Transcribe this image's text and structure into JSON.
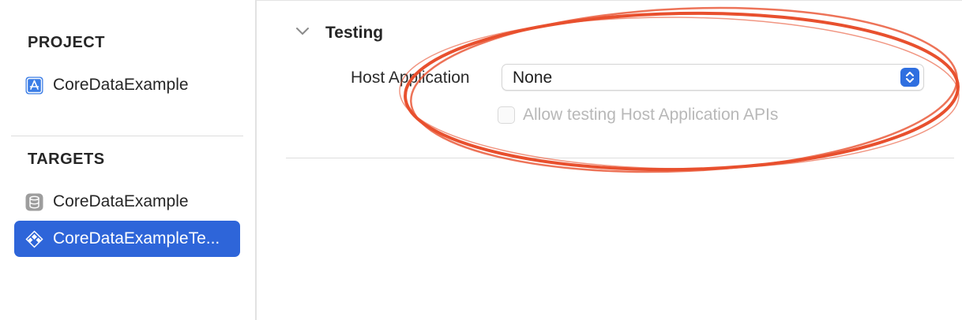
{
  "sidebar": {
    "project_title": "PROJECT",
    "project_item": {
      "label": "CoreDataExample",
      "icon": "app-store-icon"
    },
    "targets_title": "TARGETS",
    "targets": [
      {
        "label": "CoreDataExample",
        "icon": "database-icon",
        "selected": false
      },
      {
        "label": "CoreDataExampleTe...",
        "icon": "test-target-icon",
        "selected": true
      }
    ]
  },
  "testing": {
    "section_title": "Testing",
    "host_application_label": "Host Application",
    "host_application_value": "None",
    "allow_apis_label": "Allow testing Host Application APIs",
    "allow_apis_checked": false,
    "allow_apis_enabled": false
  },
  "colors": {
    "selection": "#2e65d9",
    "annotation": "#e8502e",
    "stepper": "#2f6fe0"
  }
}
